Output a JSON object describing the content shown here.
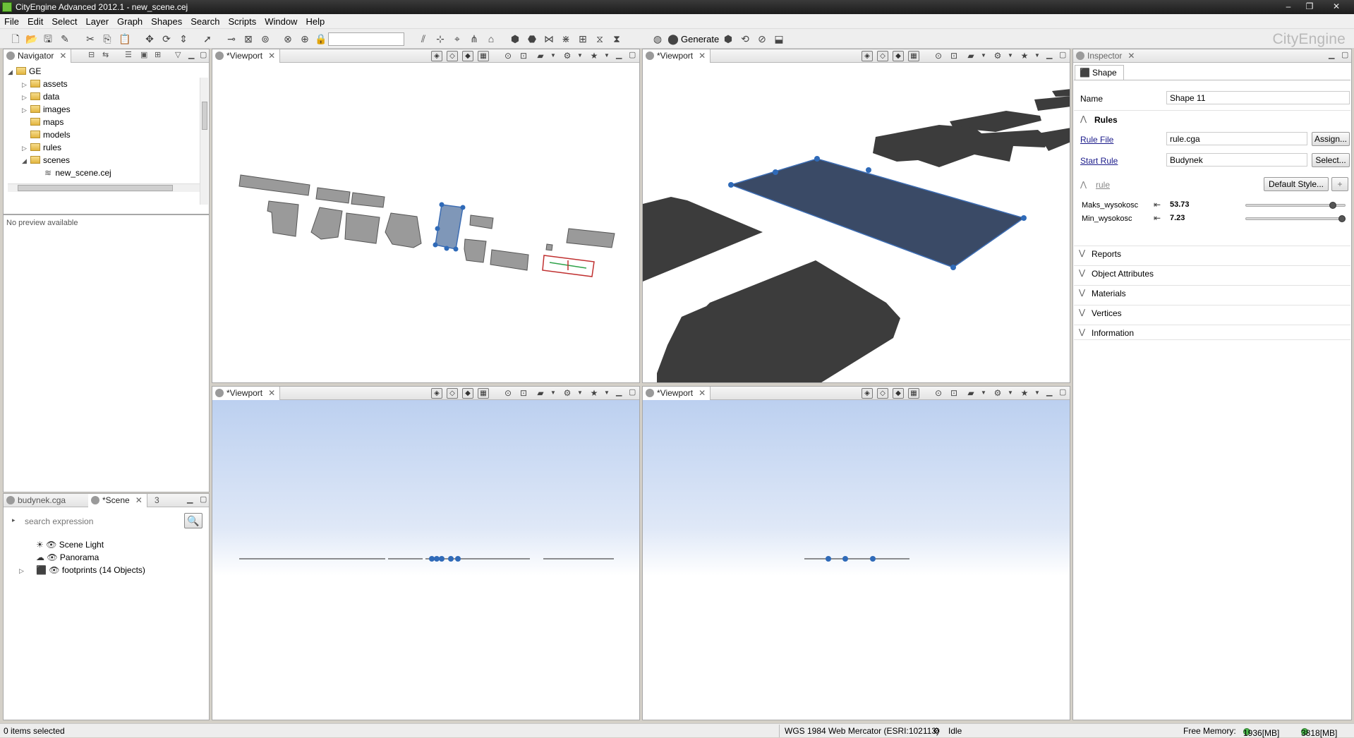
{
  "window": {
    "title": "CityEngine Advanced 2012.1 - new_scene.cej"
  },
  "menu": [
    "File",
    "Edit",
    "Select",
    "Layer",
    "Graph",
    "Shapes",
    "Search",
    "Scripts",
    "Window",
    "Help"
  ],
  "toolbar": {
    "generate_label": "Generate",
    "brand": "CityEngine",
    "search_value": ""
  },
  "navigator": {
    "tab_label": "Navigator",
    "items": [
      {
        "label": "GE",
        "type": "project",
        "expanded": true
      },
      {
        "label": "assets",
        "type": "folder"
      },
      {
        "label": "data",
        "type": "folder"
      },
      {
        "label": "images",
        "type": "folder"
      },
      {
        "label": "maps",
        "type": "folder"
      },
      {
        "label": "models",
        "type": "folder"
      },
      {
        "label": "rules",
        "type": "folder"
      },
      {
        "label": "scenes",
        "type": "folder",
        "expanded": true
      },
      {
        "label": "new_scene.cej",
        "type": "file"
      }
    ],
    "preview_text": "No preview available"
  },
  "scene_panel": {
    "tabs": [
      "budynek.cga",
      "*Scene",
      "3"
    ],
    "search_placeholder": "search expression",
    "items": [
      {
        "label": "Scene Light"
      },
      {
        "label": "Panorama"
      },
      {
        "label": "footprints (14 Objects)"
      }
    ]
  },
  "viewports": [
    {
      "tab_label": "*Viewport"
    },
    {
      "tab_label": "*Viewport"
    },
    {
      "tab_label": "*Viewport"
    },
    {
      "tab_label": "*Viewport"
    }
  ],
  "inspector": {
    "tab_label": "Inspector",
    "subtab_label": "Shape",
    "name_label": "Name",
    "name_value": "Shape 11",
    "rules_title": "Rules",
    "rule_file_label": "Rule File",
    "rule_file_value": "rule.cga",
    "assign_button": "Assign...",
    "start_rule_label": "Start Rule",
    "start_rule_value": "Budynek",
    "select_button": "Select...",
    "rule_group_label": "rule",
    "default_style_button": "Default Style...",
    "attributes": [
      {
        "name": "Maks_wysokosc",
        "value": "53.73",
        "level": 0.88
      },
      {
        "name": "Min_wysokosc",
        "value": "7.23",
        "level": 0.97
      }
    ],
    "sections": [
      "Reports",
      "Object Attributes",
      "Materials",
      "Vertices",
      "Information"
    ]
  },
  "status": {
    "selection": "0 items selected",
    "crs": "WGS 1984 Web Mercator (ESRI:102113)",
    "state": "Idle",
    "memory_label": "Free Memory:",
    "mem1": "1936[MB]",
    "mem2": "3818[MB]"
  }
}
